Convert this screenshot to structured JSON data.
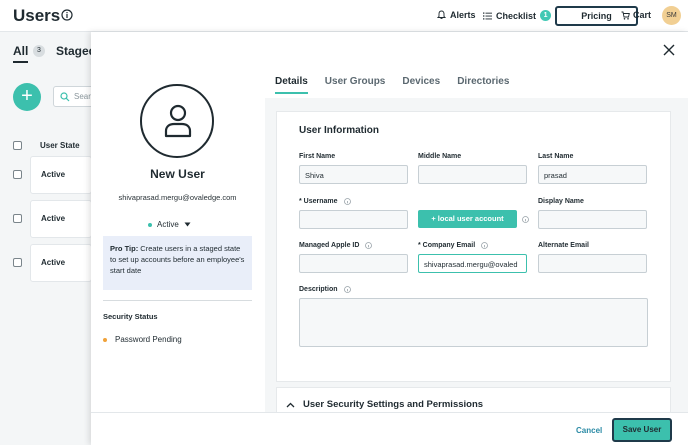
{
  "header": {
    "title": "Users",
    "alerts_label": "Alerts",
    "checklist_label": "Checklist",
    "checklist_count": "1",
    "pricing_label": "Pricing",
    "cart_label": "Cart",
    "avatar_initials": "SM"
  },
  "list": {
    "tab_all": "All",
    "tab_all_count": "3",
    "tab_staged": "Staged",
    "search_placeholder": "Sear",
    "column_state": "User State",
    "rows": [
      {
        "state": "Active"
      },
      {
        "state": "Active"
      },
      {
        "state": "Active"
      }
    ]
  },
  "drawer": {
    "user_name": "New User",
    "email": "shivaprasad.mergu@ovaledge.com",
    "status": "Active",
    "tip_bold": "Pro Tip:",
    "tip_text": " Create users in a staged state to set up accounts before an employee's start date",
    "security_status_title": "Security Status",
    "password_status": "Password Pending",
    "tabs": [
      "Details",
      "User Groups",
      "Devices",
      "Directories"
    ],
    "card_title": "User Information",
    "fields": {
      "first_name_label": "First Name",
      "first_name_value": "Shiva",
      "middle_name_label": "Middle Name",
      "middle_name_value": "",
      "last_name_label": "Last Name",
      "last_name_value": "prasad",
      "username_label": "* Username",
      "username_value": "",
      "local_account_button": "+ local user account",
      "display_name_label": "Display Name",
      "display_name_value": "",
      "managed_apple_id_label": "Managed Apple ID",
      "managed_apple_id_value": "",
      "company_email_label": "* Company Email",
      "company_email_value": "shivaprasad.mergu@ovaled",
      "alternate_email_label": "Alternate Email",
      "alternate_email_value": "",
      "description_label": "Description"
    },
    "security_section_title": "User Security Settings and Permissions",
    "cancel_label": "Cancel",
    "save_label": "Save User"
  },
  "colors": {
    "accent": "#3cc0ad",
    "tip_background": "#e9eef9",
    "pending_dot": "#f0a23a"
  }
}
